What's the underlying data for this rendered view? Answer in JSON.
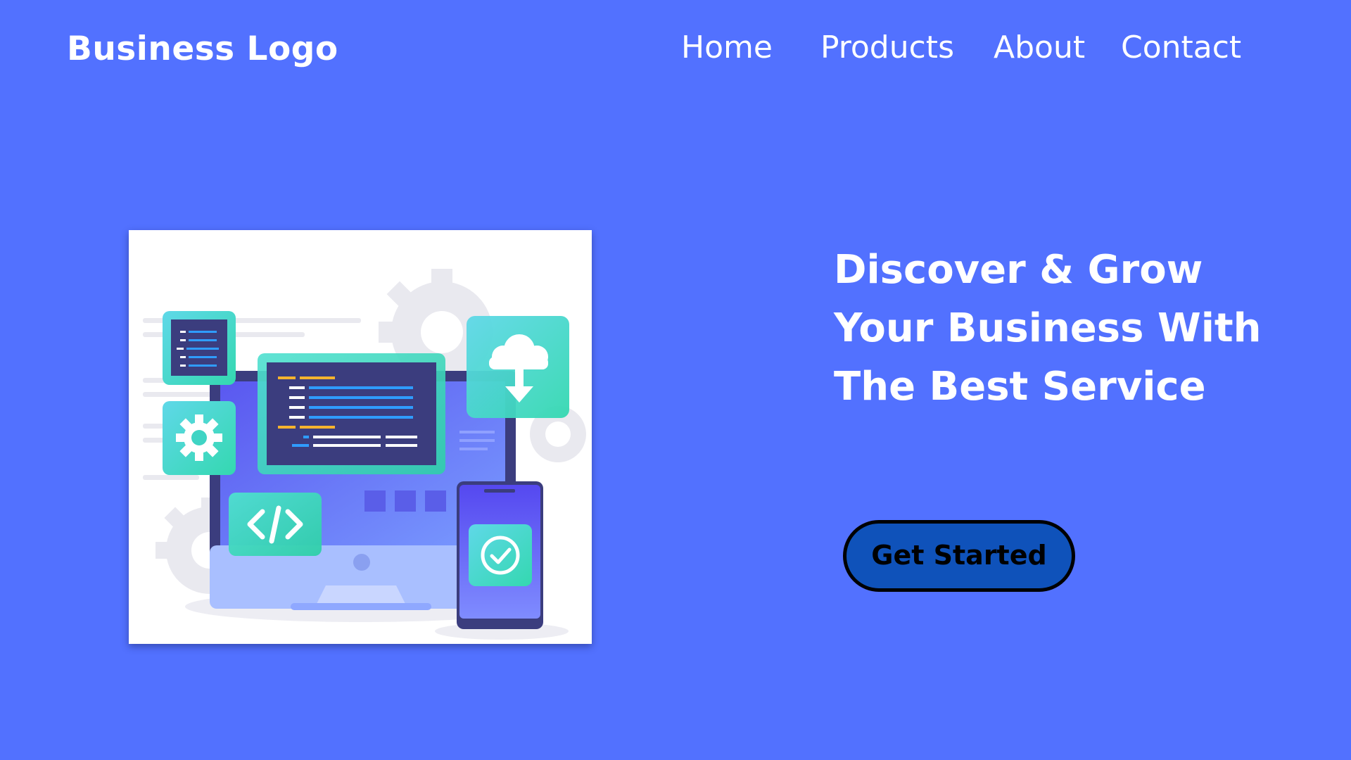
{
  "header": {
    "logo_text": "Business Logo",
    "nav": [
      {
        "label": "Home"
      },
      {
        "label": "Products"
      },
      {
        "label": "About"
      },
      {
        "label": "Contact"
      }
    ]
  },
  "hero": {
    "illustration": "web-development-illustration",
    "headline_lines": [
      "Discover & Grow",
      "Your Business With",
      "The Best Service"
    ],
    "cta_label": "Get Started"
  },
  "colors": {
    "background": "#5271ff",
    "text": "#ffffff",
    "cta_fill": "#0f52ba",
    "cta_border": "#000000",
    "illustration_teal": "#33d6c2",
    "illustration_navy": "#3b3d7e"
  },
  "icons": [
    "code-editor-icon",
    "gear-icon",
    "cloud-download-icon",
    "code-tag-icon",
    "checkmark-icon",
    "monitor-icon",
    "smartphone-icon"
  ]
}
